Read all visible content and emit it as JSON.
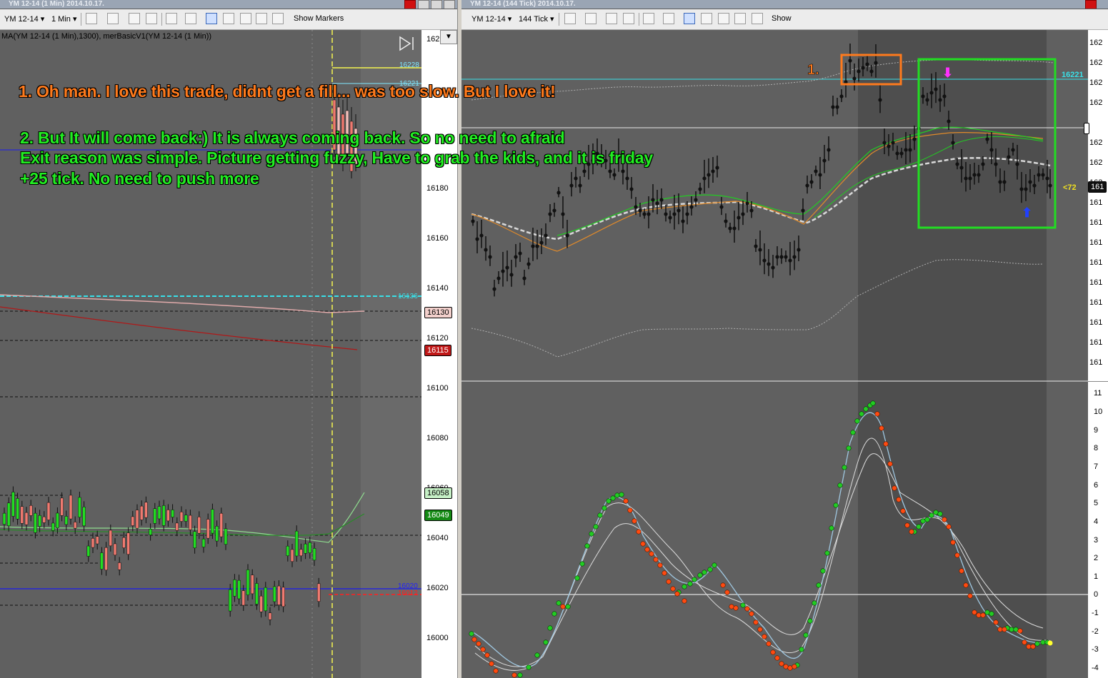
{
  "left_window": {
    "title": "YM 12-14 (1 Min)  2014.10.17.",
    "toolbar": {
      "instrument": "YM 12-14",
      "interval": "1 Min",
      "show_markers": "Show Markers"
    },
    "indicator_label": "MA(YM 12-14 (1 Min),1300), merBasicV1(YM 12-14 (1 Min))",
    "price_axis": [
      "162",
      "16180",
      "16160",
      "16140",
      "16120",
      "16100",
      "16080",
      "16060",
      "16040",
      "16020",
      "16000"
    ],
    "price_tags": [
      {
        "text": "16130",
        "bg": "#f3d0cc",
        "fg": "#000000"
      },
      {
        "text": "16115",
        "bg": "#c01818",
        "fg": "#ffffff"
      },
      {
        "text": "16058",
        "bg": "#c6f0c6",
        "fg": "#000000"
      },
      {
        "text": "16049",
        "bg": "#148a14",
        "fg": "#ffffff"
      }
    ],
    "level_labels": [
      {
        "text": "16228",
        "color": "#7fe8ff"
      },
      {
        "text": "16221",
        "color": "#7fe8ff"
      },
      {
        "text": "16136",
        "color": "#39e0e8"
      },
      {
        "text": "16020",
        "color": "#1010ff"
      },
      {
        "text": "16012",
        "color": "#ff2020"
      }
    ]
  },
  "right_window": {
    "title": "YM 12-14 (144 Tick)  2014.10.17.",
    "toolbar": {
      "instrument": "YM 12-14",
      "interval": "144 Tick",
      "show": "Show"
    },
    "price_axis": [
      "162",
      "162",
      "162",
      "162",
      "162",
      "162",
      "162",
      "161",
      "161",
      "161",
      "161",
      "161",
      "161",
      "161",
      "161",
      "161",
      "161",
      "161"
    ],
    "osc_axis": [
      "11",
      "10",
      "9",
      "8",
      "7",
      "6",
      "5",
      "4",
      "3",
      "2",
      "1",
      "0",
      "-1",
      "-2",
      "-3",
      "-4"
    ],
    "level_16221": "16221",
    "current_tag": "161",
    "last_tag": "<72",
    "markers": {
      "one": "1."
    }
  },
  "annotations": {
    "line1": "1. Oh man. I love this trade, didnt get a fill... was too slow. But I love it!",
    "line2": "2. But It will come back:) It is always coming back. So no need to afraid",
    "line3": "Exit reason was simple. Picture getting fuzzy, Have to grab the kids, and it is friday",
    "line4": "+25 tick. No need to push more"
  },
  "colors": {
    "orange_text": "#ff7a1c",
    "green_text": "#22ee22",
    "cyan_level": "#39e0e8",
    "green_box": "#22dd22",
    "orange_box": "#ff7a1c"
  }
}
